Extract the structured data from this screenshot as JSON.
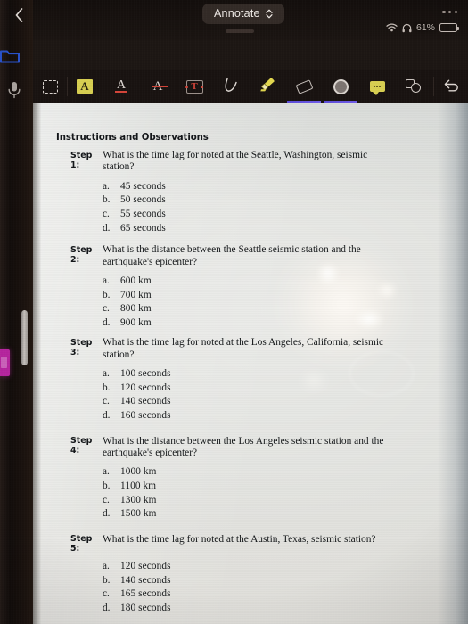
{
  "status_bar": {
    "wifi_icon": "wifi-icon",
    "headphones_icon": "headphones-icon",
    "battery_percent": "61%",
    "battery_icon": "battery-icon",
    "battery_level": 61
  },
  "nav_bar": {
    "back_icon": "chevron-left-icon",
    "title": "Annotate",
    "title_chevron_icon": "chevron-up-down-icon",
    "more_icon": "ellipsis-icon"
  },
  "toolbar": {
    "tools": [
      {
        "name": "marquee-select-tool",
        "icon": "dashed-rectangle-icon",
        "selected": false
      },
      {
        "name": "highlight-text-tool",
        "icon": "highlighted-a-icon",
        "selected": false
      },
      {
        "name": "underline-text-tool",
        "icon": "underlined-a-icon",
        "selected": false
      },
      {
        "name": "strikethrough-text-tool",
        "icon": "strikethrough-a-icon",
        "selected": false
      },
      {
        "name": "text-box-tool",
        "icon": "text-box-t-icon",
        "selected": false
      },
      {
        "name": "pen-tool",
        "icon": "pen-stroke-icon",
        "selected": false
      },
      {
        "name": "highlighter-tool",
        "icon": "highlighter-marker-icon",
        "selected": false
      },
      {
        "name": "eraser-tool",
        "icon": "eraser-icon",
        "selected": true
      },
      {
        "name": "color-swatch-tool",
        "icon": "filled-circle-icon",
        "selected": true
      },
      {
        "name": "sticky-note-tool",
        "icon": "comment-bubble-icon",
        "selected": false
      },
      {
        "name": "shapes-tool",
        "icon": "shapes-icon",
        "selected": false
      },
      {
        "name": "undo-tool",
        "icon": "undo-arrow-icon",
        "selected": false
      }
    ]
  },
  "left_edge": {
    "folder_icon": "blue-folder-icon",
    "mic_icon": "microphone-icon",
    "purple_tab": "purple-bookmark-tab",
    "drag_handle": "scroll-drag-handle",
    "accent_purple": "#b5259e"
  },
  "document": {
    "heading": "Instructions and Observations",
    "steps": [
      {
        "label": "Step 1:",
        "question": "What is the time lag for noted at the Seattle, Washington, seismic station?",
        "options": [
          {
            "letter": "a.",
            "text": "45 seconds"
          },
          {
            "letter": "b.",
            "text": "50 seconds"
          },
          {
            "letter": "c.",
            "text": "55 seconds"
          },
          {
            "letter": "d.",
            "text": "65 seconds"
          }
        ]
      },
      {
        "label": "Step 2:",
        "question": "What is the distance between the Seattle seismic station and the earthquake's epicenter?",
        "options": [
          {
            "letter": "a.",
            "text": "600 km"
          },
          {
            "letter": "b.",
            "text": "700 km"
          },
          {
            "letter": "c.",
            "text": "800 km"
          },
          {
            "letter": "d.",
            "text": "900 km"
          }
        ]
      },
      {
        "label": "Step 3:",
        "question": "What is the time lag for noted at the Los Angeles, California, seismic station?",
        "options": [
          {
            "letter": "a.",
            "text": "100 seconds"
          },
          {
            "letter": "b.",
            "text": "120 seconds"
          },
          {
            "letter": "c.",
            "text": "140 seconds"
          },
          {
            "letter": "d.",
            "text": "160 seconds"
          }
        ]
      },
      {
        "label": "Step 4:",
        "question": "What is the distance between the Los Angeles seismic station and the earthquake's epicenter?",
        "options": [
          {
            "letter": "a.",
            "text": "1000 km"
          },
          {
            "letter": "b.",
            "text": "1100 km"
          },
          {
            "letter": "c.",
            "text": "1300 km"
          },
          {
            "letter": "d.",
            "text": "1500 km"
          }
        ]
      },
      {
        "label": "Step 5:",
        "question": "What is the time lag for noted at the Austin, Texas, seismic station?",
        "options": [
          {
            "letter": "a.",
            "text": "120 seconds"
          },
          {
            "letter": "b.",
            "text": "140 seconds"
          },
          {
            "letter": "c.",
            "text": "165 seconds"
          },
          {
            "letter": "d.",
            "text": "180 seconds"
          }
        ]
      }
    ]
  }
}
